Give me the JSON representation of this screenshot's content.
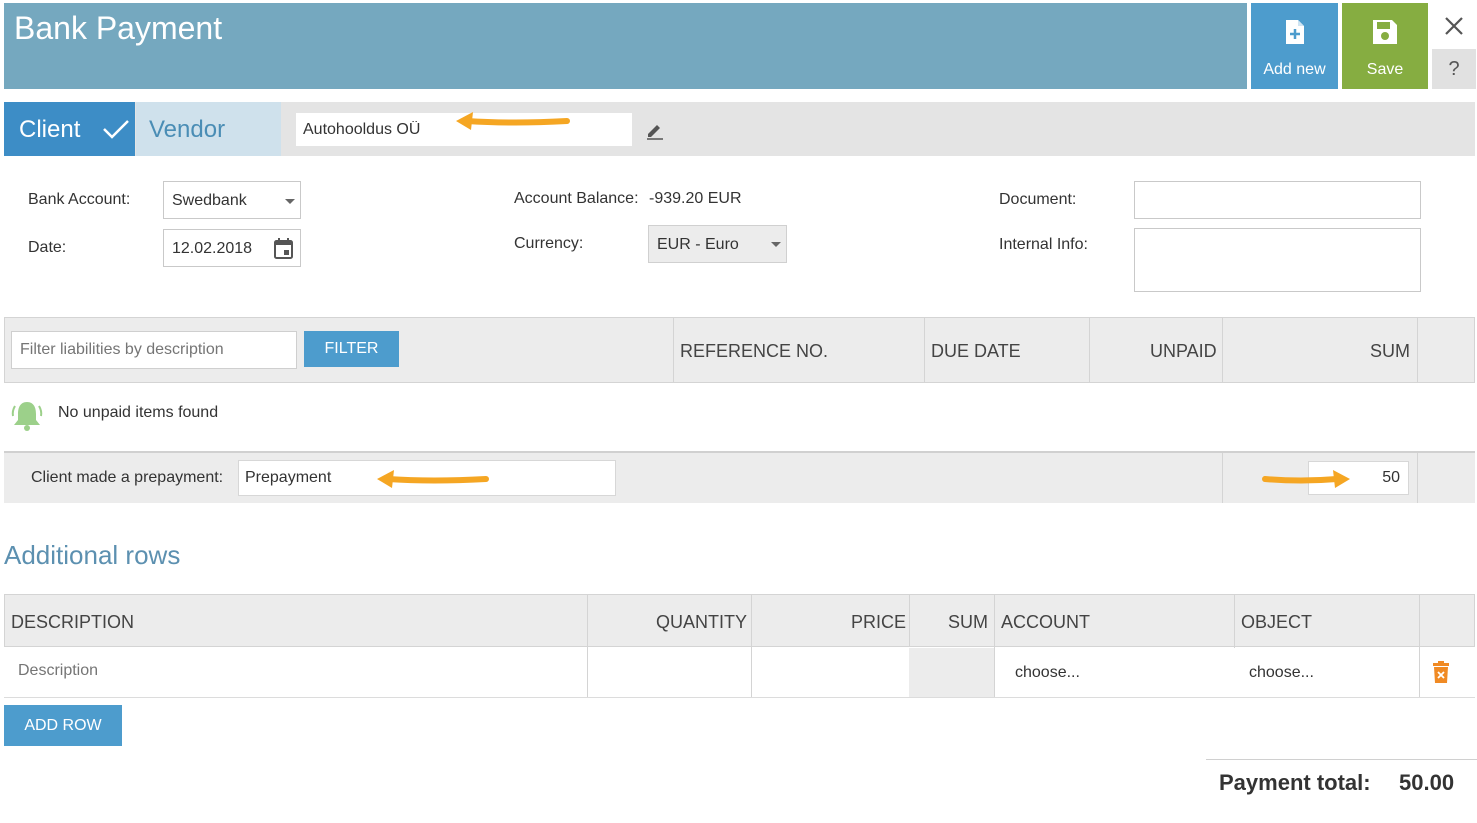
{
  "header": {
    "title": "Bank Payment",
    "add_new_label": "Add new",
    "save_label": "Save",
    "help_label": "?"
  },
  "party": {
    "client_label": "Client",
    "vendor_label": "Vendor",
    "selected": "Client",
    "name_value": "Autohooldus OÜ"
  },
  "form": {
    "bank_account_label": "Bank Account:",
    "bank_account_value": "Swedbank",
    "date_label": "Date:",
    "date_value": "12.02.2018",
    "account_balance_label": "Account Balance:",
    "account_balance_value": "-939.20 EUR",
    "currency_label": "Currency:",
    "currency_value": "EUR - Euro",
    "document_label": "Document:",
    "document_value": "",
    "internal_info_label": "Internal Info:",
    "internal_info_value": ""
  },
  "liabilities": {
    "filter_placeholder": "Filter liabilities by description",
    "filter_button": "FILTER",
    "columns": [
      "REFERENCE NO.",
      "DUE DATE",
      "UNPAID",
      "SUM"
    ],
    "empty_message": "No unpaid items found"
  },
  "prepayment": {
    "label": "Client made a prepayment:",
    "description_value": "Prepayment",
    "sum_value": "50"
  },
  "additional_rows": {
    "title": "Additional rows",
    "columns": [
      "DESCRIPTION",
      "QUANTITY",
      "PRICE",
      "SUM",
      "ACCOUNT",
      "OBJECT"
    ],
    "row": {
      "description_placeholder": "Description",
      "account_value": "choose...",
      "object_value": "choose..."
    },
    "add_row_button": "ADD ROW"
  },
  "totals": {
    "label": "Payment total:",
    "value": "50.00"
  },
  "colors": {
    "header_bg": "#75a8bf",
    "add_new_bg": "#4d9ccd",
    "save_bg": "#86ad41",
    "client_tab_bg": "#3d8dc6",
    "vendor_tab_bg": "#cfe1ec",
    "annotation_arrow": "#f5a623",
    "trash": "#f08a24"
  },
  "icons": [
    "add-document-icon",
    "floppy-disk-icon",
    "close-icon",
    "checkmark-icon",
    "pencil-icon",
    "dropdown-caret-icon",
    "calendar-icon",
    "bell-icon",
    "trash-icon",
    "annotation-arrow-icon"
  ]
}
